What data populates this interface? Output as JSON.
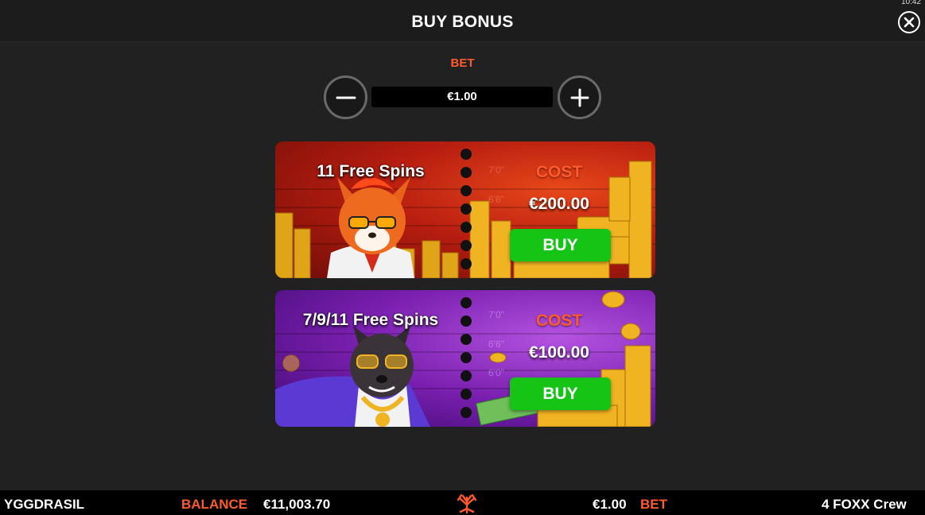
{
  "header": {
    "title": "BUY BONUS",
    "clock": "10:42"
  },
  "bet": {
    "label": "BET",
    "value": "€1.00"
  },
  "offers": [
    {
      "spins": "11 Free Spins",
      "cost_label": "COST",
      "cost": "€200.00",
      "buy_label": "BUY",
      "theme": "red",
      "character": "fox-character"
    },
    {
      "spins": "7/9/11 Free Spins",
      "cost_label": "COST",
      "cost": "€100.00",
      "buy_label": "BUY",
      "theme": "purple",
      "character": "wolf-character"
    }
  ],
  "footer": {
    "brand": "YGGDRASIL",
    "balance_label": "BALANCE",
    "balance": "€11,003.70",
    "bet_value": "€1.00",
    "bet_label": "BET",
    "game_name": "4 FOXX Crew"
  },
  "colors": {
    "accent": "#ff5a2d",
    "buy": "#15c415",
    "background": "#212121"
  },
  "icons": [
    "close-icon",
    "minus-icon",
    "plus-icon",
    "yggdrasil-logo-icon"
  ]
}
